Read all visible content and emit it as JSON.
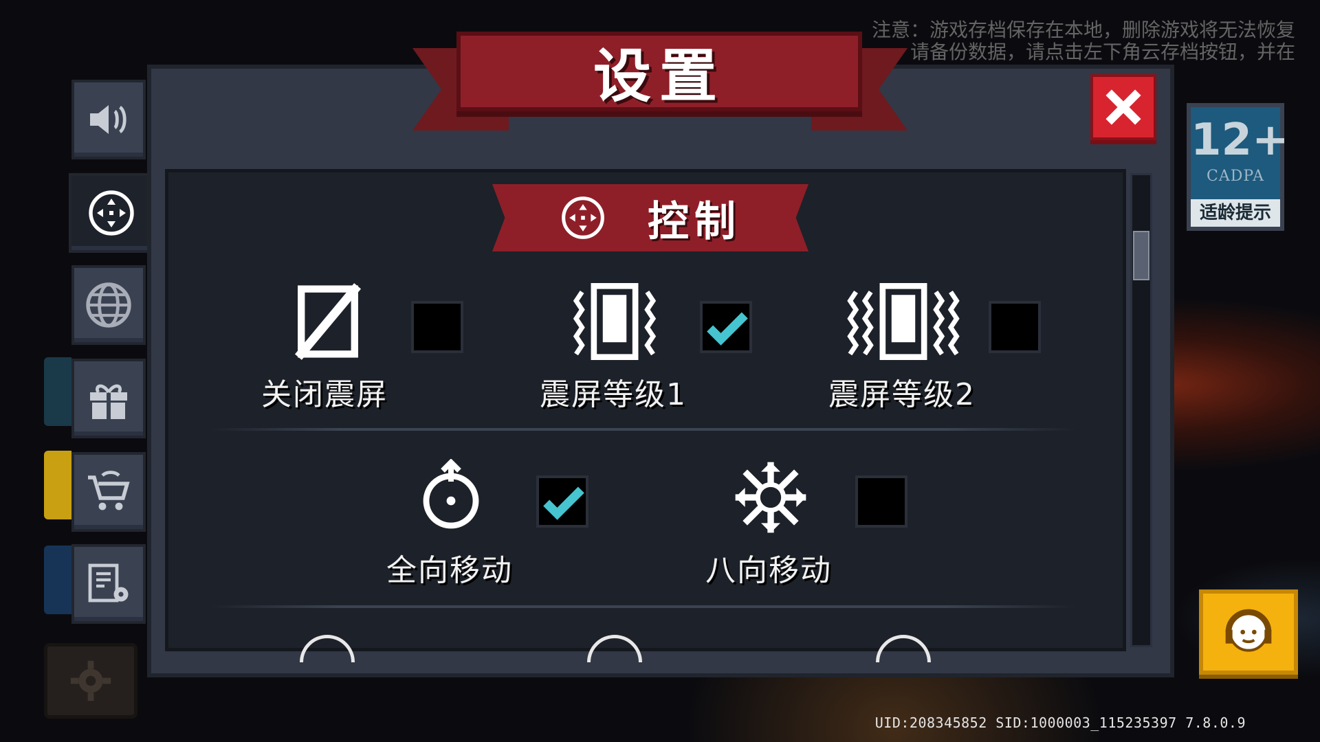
{
  "notice": {
    "line1": "注意：游戏存档保存在本地，删除游戏将无法恢复",
    "line2": "请备份数据，请点击左下角云存档按钮，并在"
  },
  "footer": {
    "uid_text": "UID:208345852 SID:1000003_115235397 7.8.0.9"
  },
  "tabs": [
    {
      "name": "sound",
      "icon": "speaker-icon"
    },
    {
      "name": "control",
      "icon": "dpad-icon",
      "active": true
    },
    {
      "name": "language",
      "icon": "globe-icon"
    },
    {
      "name": "gift",
      "icon": "gift-icon"
    },
    {
      "name": "shop",
      "icon": "cart-icon"
    },
    {
      "name": "advanced",
      "icon": "settings-doc-icon"
    }
  ],
  "dialog": {
    "title": "设置",
    "close_icon": "close-icon",
    "section_title": "控制",
    "section_icon": "dpad-icon"
  },
  "vibration_options": [
    {
      "label": "关闭震屏",
      "icon": "no-vibrate-icon",
      "checked": false
    },
    {
      "label": "震屏等级1",
      "icon": "vibrate-level1-icon",
      "checked": true
    },
    {
      "label": "震屏等级2",
      "icon": "vibrate-level2-icon",
      "checked": false
    }
  ],
  "movement_options": [
    {
      "label": "全向移动",
      "icon": "omnidirectional-icon",
      "checked": true
    },
    {
      "label": "八向移动",
      "icon": "eight-direction-icon",
      "checked": false
    }
  ],
  "age_badge": {
    "rating": "12+",
    "org": "CADPA",
    "tip": "适龄提示"
  },
  "colors": {
    "banner_red": "#8e1f28",
    "close_red": "#d8242f",
    "check_cyan": "#46c4cf",
    "panel": "#323846",
    "inner": "#1d2129",
    "service_yellow": "#f5b20e"
  }
}
